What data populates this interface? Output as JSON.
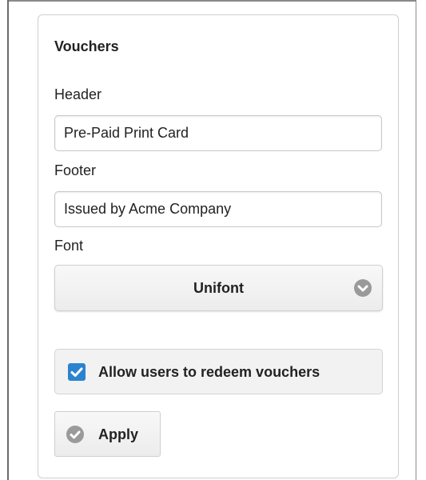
{
  "vouchers": {
    "title": "Vouchers",
    "header": {
      "label": "Header",
      "value": "Pre-Paid Print Card"
    },
    "footer": {
      "label": "Footer",
      "value": "Issued by Acme Company"
    },
    "font": {
      "label": "Font",
      "selected": "Unifont",
      "icon": "chevron-down-icon"
    },
    "redeem": {
      "label": "Allow users to redeem vouchers",
      "checked": true,
      "icon": "checkmark-icon"
    },
    "apply": {
      "label": "Apply",
      "icon": "check-circle-icon"
    }
  },
  "colors": {
    "checkbox_accent": "#2a83cf",
    "icon_gray": "#9a9a9a"
  }
}
